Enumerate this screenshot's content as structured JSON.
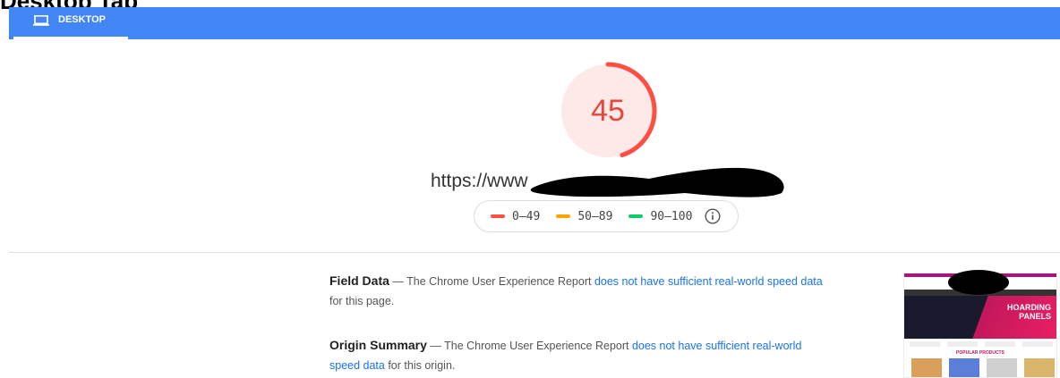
{
  "caption": "Desktop Tab",
  "tabs": [
    {
      "label": "DESKTOP",
      "icon": "laptop-icon",
      "active": true
    }
  ],
  "score": {
    "value": "45",
    "fraction": 0.45,
    "color": "#e8453c",
    "bg": "#fde9e7"
  },
  "url_prefix": "https://www",
  "legend": [
    {
      "range": "0–49",
      "color": "#ff4e42"
    },
    {
      "range": "50–89",
      "color": "#ffa400"
    },
    {
      "range": "90–100",
      "color": "#0cce6b"
    }
  ],
  "field_data": {
    "title": "Field Data",
    "sep": " — The Chrome User Experience Report ",
    "link": "does not have sufficient real-world speed data",
    "suffix": " for this page."
  },
  "origin_summary": {
    "title": "Origin Summary",
    "sep": " — The Chrome User Experience Report ",
    "link": "does not have sufficient real-world speed data",
    "suffix": " for this origin."
  },
  "thumbnail": {
    "hero_title_1": "HOARDING",
    "hero_title_2": "PANELS",
    "popular": "POPULAR PRODUCTS"
  }
}
